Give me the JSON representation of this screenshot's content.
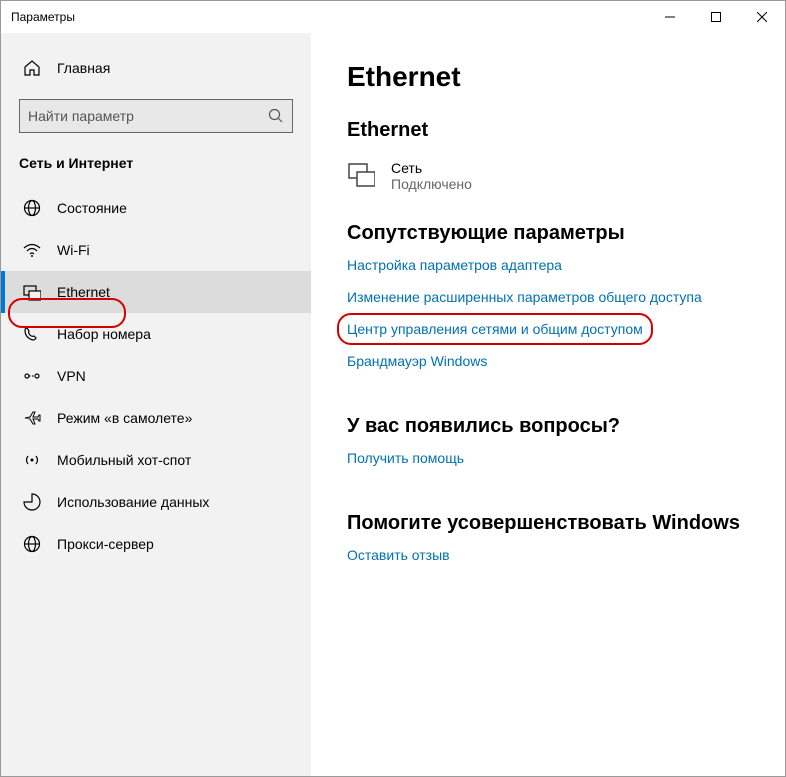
{
  "window": {
    "title": "Параметры"
  },
  "sidebar": {
    "home": "Главная",
    "search_placeholder": "Найти параметр",
    "category": "Сеть и Интернет",
    "items": [
      {
        "label": "Состояние"
      },
      {
        "label": "Wi-Fi"
      },
      {
        "label": "Ethernet"
      },
      {
        "label": "Набор номера"
      },
      {
        "label": "VPN"
      },
      {
        "label": "Режим «в самолете»"
      },
      {
        "label": "Мобильный хот-спот"
      },
      {
        "label": "Использование данных"
      },
      {
        "label": "Прокси-сервер"
      }
    ]
  },
  "main": {
    "title": "Ethernet",
    "section": "Ethernet",
    "network": {
      "name": "Сеть",
      "status": "Подключено"
    },
    "related_heading": "Сопутствующие параметры",
    "links": {
      "adapter": "Настройка параметров адаптера",
      "sharing": "Изменение расширенных параметров общего доступа",
      "center": "Центр управления сетями и общим доступом",
      "firewall": "Брандмауэр Windows"
    },
    "help_heading": "У вас появились вопросы?",
    "help_link": "Получить помощь",
    "improve_heading": "Помогите усовершенствовать Windows",
    "feedback_link": "Оставить отзыв"
  }
}
